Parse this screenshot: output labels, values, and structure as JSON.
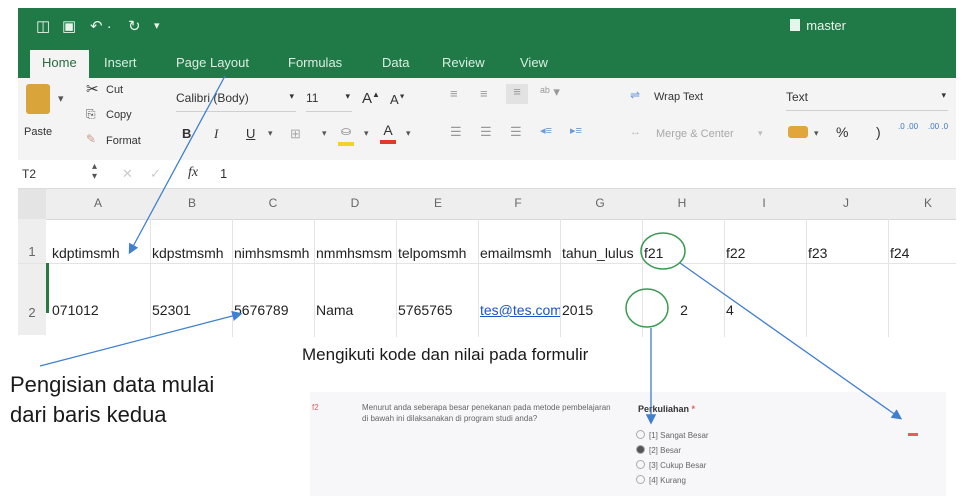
{
  "titlebar": {
    "doc_name": "master"
  },
  "tabs": [
    "Home",
    "Insert",
    "Page Layout",
    "Formulas",
    "Data",
    "Review",
    "View"
  ],
  "clipboard": {
    "paste": "Paste",
    "cut": "Cut",
    "copy": "Copy",
    "format": "Format"
  },
  "font": {
    "name": "Calibri (Body)",
    "size": "11",
    "bold": "B",
    "italic": "I",
    "underline": "U",
    "grow": "A",
    "shrink": "A",
    "color_letter": "A"
  },
  "alignment": {
    "wrap": "Wrap Text",
    "merge": "Merge & Center"
  },
  "number": {
    "format": "Text",
    "percent": "%",
    "comma": ")",
    "inc_decimal": ".0 .00",
    "dec_decimal": ".00 .0"
  },
  "formula_bar": {
    "cell_ref": "T2",
    "fx": "fx",
    "value": "1"
  },
  "sheet": {
    "columns": [
      "A",
      "B",
      "C",
      "D",
      "E",
      "F",
      "G",
      "H",
      "I",
      "J",
      "K"
    ],
    "row_numbers": [
      "1",
      "2"
    ],
    "row1": [
      "kdptimsmh",
      "kdpstmsmh",
      "nimhsmsmh",
      "nmmhsmsm",
      "telpomsmh",
      "emailmsmh",
      "tahun_lulus",
      "f21",
      "f22",
      "f23",
      "f24"
    ],
    "row2": [
      "071012",
      "52301",
      "5676789",
      "Nama",
      "5765765",
      "tes@tes.com",
      "2015",
      "2",
      "4",
      "",
      ""
    ]
  },
  "annotations": {
    "left_line1": "Pengisian data mulai",
    "left_line2": "dari baris kedua",
    "center": "Mengikuti kode dan nilai pada formulir"
  },
  "form": {
    "number": "f2",
    "question": "Menurut anda seberapa besar penekanan pada metode pembelajaran di bawah ini dilaksanakan di program studi anda?",
    "section": "Perkuliahan",
    "options": [
      "[1] Sangat Besar",
      "[2] Besar",
      "[3] Cukup Besar",
      "[4] Kurang"
    ],
    "selected_index": 1
  },
  "colors": {
    "ribbon_green": "#1f7a48",
    "arrow_blue": "#3f7fd0",
    "circle_green": "#3a9a50"
  }
}
